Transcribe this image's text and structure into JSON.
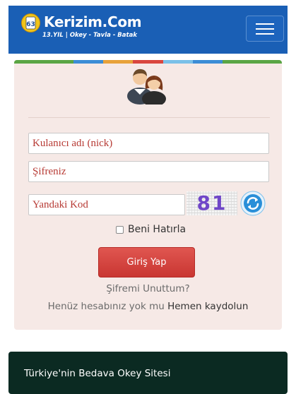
{
  "header": {
    "brand": "Kerizim.Com",
    "tagline": "13.YIL | Okey - Tavla - Batak",
    "logo_icon": "okey-tile-icon",
    "menu_icon": "hamburger-menu-icon",
    "color": "#1a5fb5"
  },
  "login": {
    "stripe_colors": [
      "#5aa544",
      "#5aa544",
      "#3c8dd6",
      "#e8a23a",
      "#d9463f",
      "#7ac0e8",
      "#3c8dd6",
      "#5aa544",
      "#5aa544"
    ],
    "avatar_icon": "users-icon",
    "username_placeholder": "Kulanıcı adı (nick)",
    "password_placeholder": "Şifreniz",
    "code_placeholder": "Yandaki Kod",
    "captcha_code": "81",
    "refresh_icon": "refresh-icon",
    "remember_label": "Beni Hatırla",
    "submit_label": "Giriş Yap",
    "forgot_label": "Şifremi Unuttum?",
    "signup_prompt": "Henüz hesabınız yok mu",
    "signup_link": "Hemen kaydolun"
  },
  "footer": {
    "text": "Türkiye'nin Bedava Okey Sitesi"
  }
}
